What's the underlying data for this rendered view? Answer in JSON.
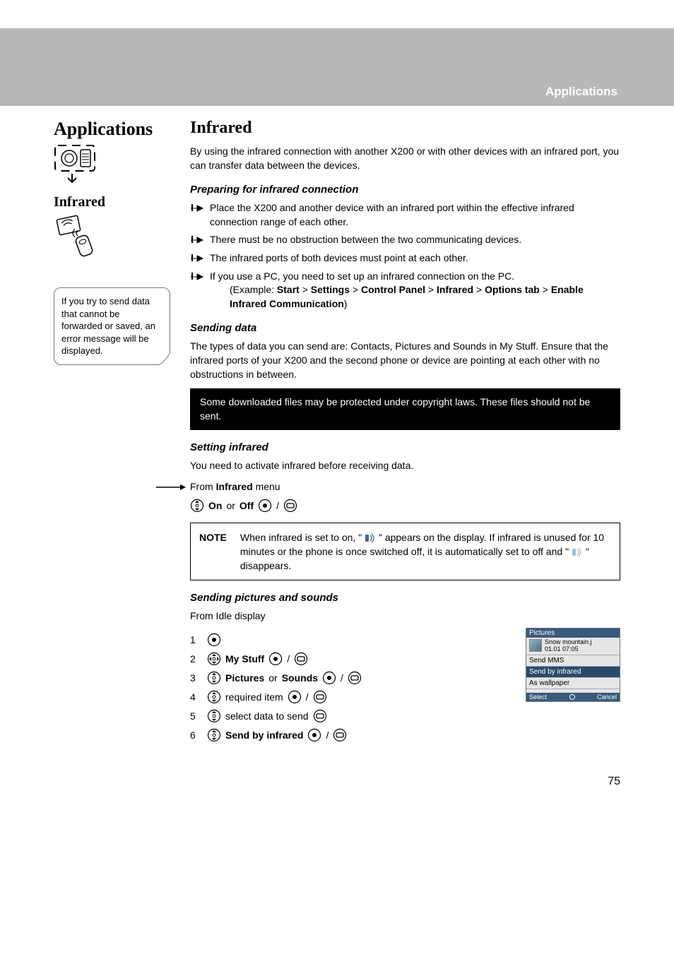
{
  "header": {
    "section_label": "Applications"
  },
  "sidebar": {
    "title": "Applications",
    "subtitle": "Infrared",
    "tip": "If you try to send data that cannot be forwarded or saved, an error message will be displayed."
  },
  "section": {
    "title": "Infrared",
    "intro": "By using the infrared connection with another X200 or with other devices with an infrared port, you can transfer data between the devices.",
    "preparing": {
      "heading": "Preparing for infrared connection",
      "items": [
        "Place the X200 and another device with an infrared port within the effective infrared connection range of each other.",
        "There must be no obstruction between the two communicating devices.",
        "The infrared ports of both devices must point at each other.",
        "If you use a PC, you need to set up an infrared connection on the PC."
      ],
      "example_prefix": "(Example: ",
      "example_path": [
        "Start",
        "Settings",
        "Control Panel",
        "Infrared",
        "Options tab",
        "Enable Infrared Communication"
      ],
      "example_suffix": ")"
    },
    "sending_data": {
      "heading": "Sending data",
      "text": "The types of data you can send are: Contacts, Pictures and Sounds in My Stuff. Ensure that the infrared ports of your X200 and the second phone or device are pointing at each other with no obstructions in between.",
      "warning": "Some downloaded files may be protected under copyright laws. These files should not be sent."
    },
    "setting": {
      "heading": "Setting infrared",
      "text": "You need to activate infrared before receiving data.",
      "from_line_prefix": "From ",
      "from_line_bold": "Infrared",
      "from_line_suffix": " menu",
      "toggle_on": "On",
      "toggle_or": " or ",
      "toggle_off": "Off",
      "note_label": "NOTE",
      "note_part1": "When infrared is set to on, \" ",
      "note_part2": " \" appears on the display. If infrared is unused for 10 minutes or the phone is once switched off, it is automatically set to off and \" ",
      "note_part3": " \" disappears."
    },
    "sending_pics": {
      "heading": "Sending pictures and sounds",
      "from": "From Idle display",
      "step2_bold": "My Stuff",
      "step3_a": "Pictures",
      "step3_or": " or ",
      "step3_b": "Sounds",
      "step4": " required item ",
      "step5": " select data to send ",
      "step6_bold": "Send by infrared"
    },
    "screenshot": {
      "title": "Pictures",
      "filename": "Snow mountain.j",
      "datetime": "01.01 07:05",
      "menu1": "Send MMS",
      "menu2": "Send by infrared",
      "menu3": "As wallpaper",
      "soft_left": "Select",
      "soft_right": "Cancel"
    }
  },
  "page_number": "75"
}
